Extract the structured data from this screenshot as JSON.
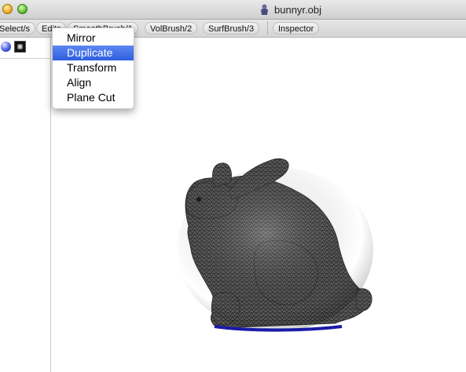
{
  "window": {
    "title": "bunnyr.obj",
    "title_icon": "app-figure-icon"
  },
  "toolbar": {
    "buttons": [
      {
        "label": "Select/s"
      },
      {
        "label": "Edits"
      },
      {
        "label": "SmoothBrush/1"
      },
      {
        "label": "VolBrush/2"
      },
      {
        "label": "SurfBrush/3"
      },
      {
        "label": "Inspector"
      }
    ]
  },
  "left_panel": {
    "icons": [
      "sphere-icon",
      "material-square-icon"
    ]
  },
  "edits_menu": {
    "items": [
      {
        "label": "Mirror",
        "selected": false
      },
      {
        "label": "Duplicate",
        "selected": true
      },
      {
        "label": "Transform",
        "selected": false
      },
      {
        "label": "Align",
        "selected": false
      },
      {
        "label": "Plane Cut",
        "selected": false
      }
    ]
  },
  "viewport": {
    "model": "bunny wireframe mesh",
    "mesh_color": "#3a3a3a",
    "base_color": "#1a1aa8"
  },
  "colors": {
    "menu_highlight": "#3d6ce6",
    "toolbar_bg": "#dedede"
  }
}
